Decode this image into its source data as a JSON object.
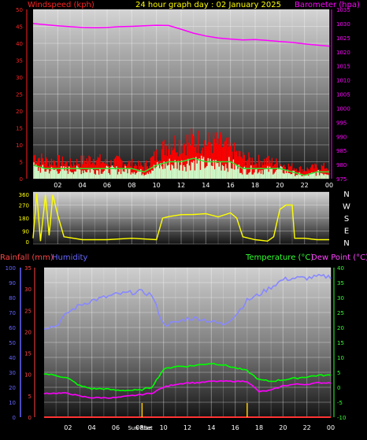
{
  "title": "24 hour graph day : 02 January 2025",
  "colors": {
    "wind_axis": "#ff2222",
    "wind_gust": "#ff0000",
    "wind_avg": "#33dd33",
    "wind_fill": "#ccffcc",
    "baro": "#ff00ff",
    "dir": "#ffff00",
    "rain": "#ff3333",
    "humidity": "#8888ff",
    "temperature": "#00ff00",
    "dewpoint": "#ff00ff",
    "rain_axis": "#ff4444",
    "hum_axis": "#6666ff",
    "temp_axis": "#33ff33",
    "dew_axis": "#ff44ff",
    "text": "#ffffff"
  },
  "chart_data": [
    {
      "type": "area",
      "name_windspeed": "Windspeed (kph)",
      "name_barometer": "Barometer (hpa)",
      "x_ticks": [
        "02",
        "04",
        "06",
        "08",
        "10",
        "12",
        "14",
        "16",
        "18",
        "20",
        "22",
        "00"
      ],
      "y_left_ticks": [
        "0",
        "5",
        "10",
        "15",
        "20",
        "25",
        "30",
        "35",
        "40",
        "45",
        "50"
      ],
      "y_left_range": [
        0,
        50
      ],
      "y_right_ticks": [
        "975",
        "980",
        "985",
        "990",
        "995",
        "1000",
        "1005",
        "1010",
        "1015",
        "1020",
        "1025",
        "1030",
        "1035"
      ],
      "y_right_range": [
        975,
        1035
      ],
      "hours": [
        0,
        1,
        2,
        3,
        4,
        5,
        6,
        7,
        8,
        9,
        10,
        11,
        12,
        13,
        14,
        15,
        16,
        17,
        18,
        19,
        20,
        21,
        22,
        23,
        24
      ],
      "barometer": [
        1030.0,
        1029.6,
        1029.2,
        1028.9,
        1028.6,
        1028.5,
        1028.6,
        1028.9,
        1029.0,
        1029.2,
        1029.4,
        1029.3,
        1028.0,
        1026.6,
        1025.6,
        1024.9,
        1024.5,
        1024.2,
        1024.3,
        1024.0,
        1023.6,
        1023.3,
        1022.8,
        1022.4,
        1022.0
      ],
      "gust": [
        8,
        6,
        6,
        5,
        6,
        7,
        5,
        6,
        5,
        4,
        8,
        12,
        12,
        13,
        12,
        12,
        10,
        7,
        6,
        6,
        5,
        4,
        3,
        4,
        4
      ],
      "average": [
        4,
        3,
        3,
        3,
        3,
        3,
        3,
        3,
        3,
        2,
        4,
        5,
        5,
        6,
        5,
        5,
        5,
        3,
        3,
        3,
        3,
        2,
        1,
        2,
        2
      ]
    },
    {
      "type": "line",
      "name": "Wind direction",
      "x_ticks": [
        "02",
        "04",
        "06",
        "08",
        "10",
        "12",
        "14",
        "16",
        "18",
        "20",
        "22",
        "00"
      ],
      "y_ticks": [
        "360",
        "270",
        "180",
        "90",
        "0"
      ],
      "y_range": [
        0,
        360
      ],
      "direction_labels": [
        "N",
        "W",
        "S",
        "E",
        "N"
      ],
      "hours": [
        0,
        0.3,
        0.6,
        1.0,
        1.3,
        1.6,
        2.0,
        2.5,
        4,
        6,
        8,
        10,
        10.5,
        11,
        12,
        13,
        14,
        15,
        16,
        16.5,
        17,
        18,
        19,
        19.5,
        20,
        20.5,
        21,
        21.2,
        22,
        23,
        24
      ],
      "values": [
        40,
        350,
        20,
        340,
        60,
        340,
        200,
        50,
        30,
        30,
        40,
        30,
        190,
        200,
        210,
        205,
        215,
        200,
        210,
        190,
        50,
        30,
        20,
        50,
        240,
        270,
        270,
        40,
        40,
        30,
        30
      ]
    },
    {
      "type": "line",
      "name_rain": "Rainfall (mm)",
      "name_humidity": "Humidity",
      "name_temperature": "Temperature (°C)",
      "name_dewpoint": "Dew Point (°C)",
      "x_ticks": [
        "02",
        "04",
        "06",
        "08",
        "10",
        "12",
        "14",
        "16",
        "18",
        "20",
        "22",
        "00"
      ],
      "sun_labels": [
        "Sun Rise",
        "Set"
      ],
      "sunrise_hour": 8.2,
      "sunset_hour": 17.0,
      "hum_ticks": [
        "0",
        "10",
        "20",
        "30",
        "40",
        "50",
        "60",
        "70",
        "80",
        "90",
        "100"
      ],
      "hum_range": [
        0,
        100
      ],
      "rain_ticks": [
        "0",
        "5",
        "10",
        "15",
        "20",
        "25",
        "30",
        "35"
      ],
      "rain_range": [
        0,
        35
      ],
      "temp_ticks": [
        "-10",
        "-5",
        "0",
        "5",
        "10",
        "15",
        "20",
        "25",
        "30",
        "35",
        "40"
      ],
      "temp_range": [
        -10,
        40
      ],
      "hours": [
        0,
        1,
        2,
        3,
        4,
        5,
        6,
        7,
        8,
        9,
        10,
        11,
        12,
        13,
        14,
        15,
        16,
        17,
        18,
        19,
        20,
        21,
        22,
        23,
        24
      ],
      "humidity": [
        60,
        61,
        70,
        75,
        78,
        80,
        82,
        83,
        84,
        82,
        62,
        63,
        66,
        66,
        64,
        62,
        68,
        78,
        82,
        87,
        92,
        93,
        93,
        94,
        94
      ],
      "temperature": [
        4.5,
        4.0,
        3.0,
        0.5,
        -0.5,
        -0.5,
        -1.0,
        -1.0,
        -1.0,
        0.0,
        6.0,
        7.0,
        7.0,
        7.5,
        8.0,
        7.5,
        6.5,
        5.5,
        2.5,
        2.0,
        2.5,
        3.0,
        3.5,
        4.0,
        4.0
      ],
      "dewpoint": [
        -2.0,
        -2.0,
        -2.0,
        -3.0,
        -3.5,
        -3.5,
        -3.5,
        -3.0,
        -2.5,
        -2.0,
        0.0,
        1.0,
        1.5,
        1.5,
        2.0,
        2.0,
        2.0,
        2.0,
        -1.5,
        -1.0,
        0.5,
        1.0,
        1.0,
        1.5,
        1.5
      ],
      "rainfall": [
        0,
        0,
        0,
        0,
        0,
        0,
        0,
        0,
        0,
        0,
        0,
        0,
        0,
        0,
        0,
        0,
        0,
        0,
        0,
        0,
        0,
        0,
        0,
        0,
        0
      ]
    }
  ]
}
